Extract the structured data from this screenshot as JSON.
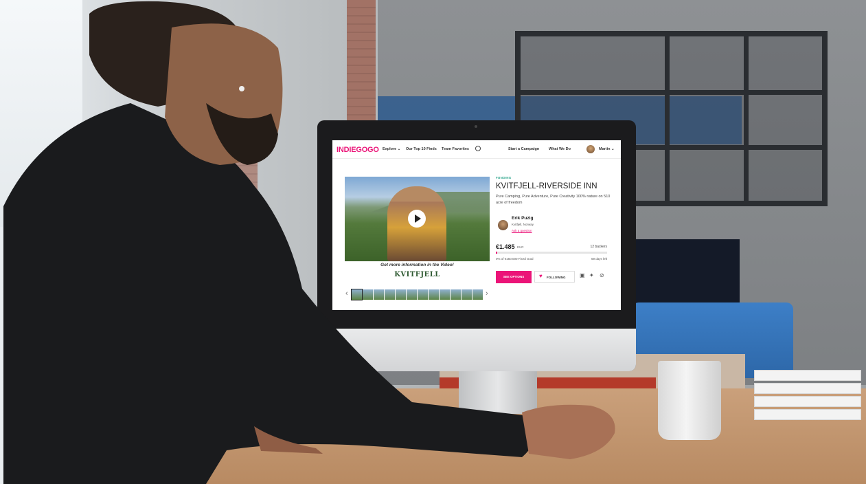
{
  "nav": {
    "logo": "INDIEGOGO",
    "explore": "Explore ⌄",
    "top10": "Our Top 10 Finds",
    "favorites": "Team Favorites",
    "start": "Start a Campaign",
    "whatwedo": "What We Do",
    "user": "Martin ⌄"
  },
  "media": {
    "caption": "Get more information in the Video!",
    "brand": "KVITFJELL",
    "thumbnail_count": 12,
    "prev_arrow": "‹",
    "next_arrow": "›"
  },
  "campaign": {
    "tag": "FUNDING",
    "title": "KVITFJELL-RIVERSIDE INN",
    "blurb": "Pure Camping, Pure Adventure, Pure Creativity 100% nature on 510 acre of freedom",
    "owner_name": "Erik Puzig",
    "owner_location": "Kvitfjell, Norway",
    "owner_link": "Ask a question",
    "amount": "€1.485",
    "currency": "EUR",
    "backers": "12 backers",
    "progress_pct": 1,
    "goal": "0% of €150.000 Fixed Goal",
    "days_left": "59 days left",
    "see_options": "SEE OPTIONS",
    "following": "FOLLOWING"
  },
  "colors": {
    "brand_pink": "#eb1478",
    "tag_teal": "#2aa38a"
  }
}
